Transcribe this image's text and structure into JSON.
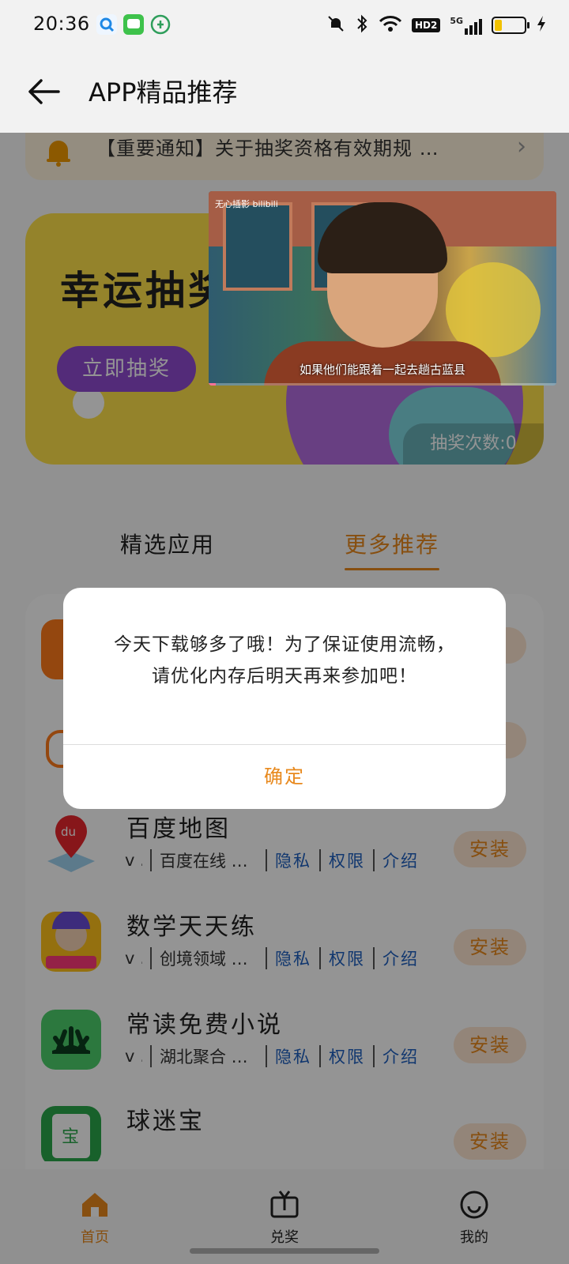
{
  "status_bar": {
    "time": "20:36",
    "network": "5G",
    "hd_badge": "HD2",
    "battery_level": 0.25,
    "icons": [
      "search-app-icon",
      "messages-app-icon",
      "health-app-icon",
      "mute-icon",
      "bluetooth-icon",
      "wifi-icon",
      "signal-icon",
      "charging-icon"
    ]
  },
  "header": {
    "title": "APP精品推荐",
    "back_icon": "arrow-left-icon"
  },
  "notice": {
    "text": "【重要通知】关于抽奖资格有效期规 …",
    "icon": "bell-icon"
  },
  "banner": {
    "title": "幸运抽奖",
    "button": "立即抽奖",
    "draw_count": "抽奖次数:0"
  },
  "tabs": [
    {
      "label": "精选应用",
      "selected": false
    },
    {
      "label": "更多推荐",
      "selected": true
    }
  ],
  "apps": [
    {
      "name": "百度地图",
      "version": "v ..",
      "developer": "百度在线 …",
      "privacy": "隐私",
      "permission": "权限",
      "intro": "介绍",
      "install": "安装"
    },
    {
      "name": "数学天天练",
      "version": "v …",
      "developer": "创境领域 …",
      "privacy": "隐私",
      "permission": "权限",
      "intro": "介绍",
      "install": "安装"
    },
    {
      "name": "常读免费小说",
      "version": "v …",
      "developer": "湖北聚合 …",
      "privacy": "隐私",
      "permission": "权限",
      "intro": "介绍",
      "install": "安装"
    },
    {
      "name": "球迷宝",
      "install": "安装"
    }
  ],
  "dialog": {
    "message_line1": "今天下载够多了哦！为了保证使用流畅，",
    "message_line2": "请优化内存后明天再来参加吧！",
    "ok": "确定"
  },
  "video": {
    "logo": "无心插影 bilibili",
    "subtitle": "如果他们能跟着一起去趟古蓝县",
    "progress": 0.02
  },
  "bottom_nav": [
    {
      "label": "首页",
      "icon": "home-icon",
      "active": true
    },
    {
      "label": "兑奖",
      "icon": "tv-icon",
      "active": false
    },
    {
      "label": "我的",
      "icon": "smile-icon",
      "active": false
    }
  ],
  "colors": {
    "accent": "#e8891d",
    "link": "#1e5fbf",
    "banner": "#ffe24a",
    "draw_button": "#8f4bd1"
  }
}
